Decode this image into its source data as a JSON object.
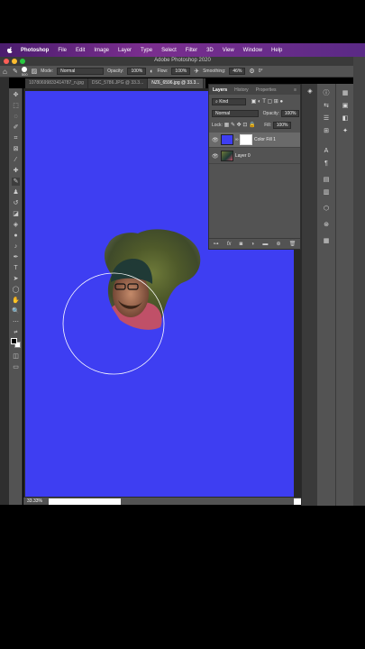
{
  "menubar": {
    "apple": "",
    "items": [
      "Photoshop",
      "File",
      "Edit",
      "Image",
      "Layer",
      "Type",
      "Select",
      "Filter",
      "3D",
      "View",
      "Window",
      "Help"
    ]
  },
  "window": {
    "title": "Adobe Photoshop 2020"
  },
  "options": {
    "brush_size": "500",
    "mode_label": "Mode:",
    "mode_value": "Normal",
    "opacity_label": "Opacity:",
    "opacity_value": "100%",
    "flow_label": "Flow:",
    "flow_value": "100%",
    "smoothing_label": "Smoothing:",
    "smoothing_value": "46%",
    "angle_value": "0°"
  },
  "doc_tabs": [
    {
      "label": "10780699833414787_n.jpg",
      "active": false
    },
    {
      "label": "DSC_5786.JPG @ 33.3...",
      "active": false
    },
    {
      "label": "NZ6_6596.jpg @ 33.3...",
      "active": true
    }
  ],
  "status": {
    "zoom": "33.33%"
  },
  "layers_panel": {
    "tabs": [
      "Layers",
      "History",
      "Properties"
    ],
    "active_tab": "Layers",
    "filter_kind": "Kind",
    "blend_mode": "Normal",
    "opacity_label": "Opacity:",
    "opacity_value": "100%",
    "lock_label": "Lock:",
    "fill_label": "Fill:",
    "fill_value": "100%",
    "layers": [
      {
        "name": "Color Fill 1",
        "selected": true,
        "thumb_color": "#3e3ef2"
      },
      {
        "name": "Layer 0",
        "selected": false
      }
    ],
    "bottom_icons": [
      "link-icon",
      "fx-icon",
      "mask-icon",
      "adjustment-icon",
      "group-icon",
      "new-layer-icon",
      "trash-icon"
    ],
    "bottom_fx": "fx"
  },
  "colors": {
    "canvas_blue": "#3e3ef2",
    "panel_gray": "#535353",
    "menubar_purple": "#7b2e8f"
  }
}
